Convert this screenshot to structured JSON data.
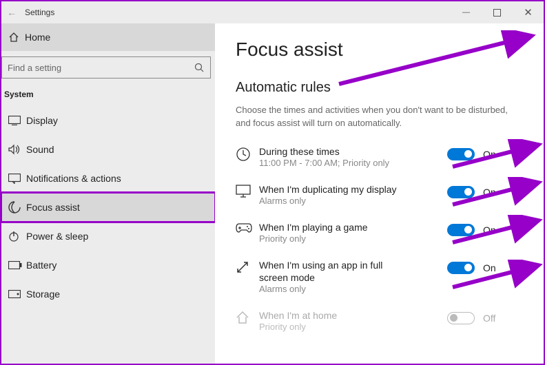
{
  "window": {
    "title": "Settings"
  },
  "sidebar": {
    "home_label": "Home",
    "search_placeholder": "Find a setting",
    "group_label": "System",
    "items": [
      {
        "label": "Display"
      },
      {
        "label": "Sound"
      },
      {
        "label": "Notifications & actions"
      },
      {
        "label": "Focus assist"
      },
      {
        "label": "Power & sleep"
      },
      {
        "label": "Battery"
      },
      {
        "label": "Storage"
      }
    ]
  },
  "content": {
    "page_title": "Focus assist",
    "section_title": "Automatic rules",
    "section_desc": "Choose the times and activities when you don't want to be disturbed, and focus assist will turn on automatically.",
    "rules": [
      {
        "title": "During these times",
        "sub": "11:00 PM - 7:00 AM; Priority only",
        "state": "On"
      },
      {
        "title": "When I'm duplicating my display",
        "sub": "Alarms only",
        "state": "On"
      },
      {
        "title": "When I'm playing a game",
        "sub": "Priority only",
        "state": "On"
      },
      {
        "title": "When I'm using an app in full screen mode",
        "sub": "Alarms only",
        "state": "On"
      },
      {
        "title": "When I'm at home",
        "sub": "Priority only",
        "state": "Off",
        "disabled": true
      }
    ]
  }
}
